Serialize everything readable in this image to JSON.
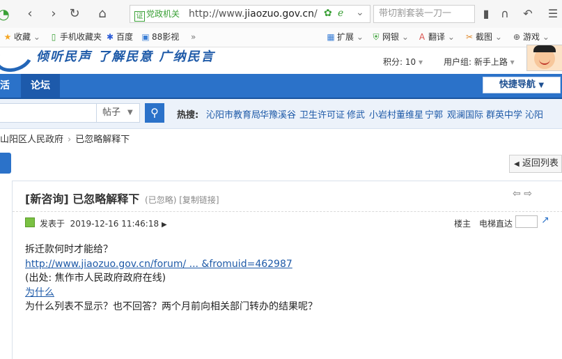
{
  "browser": {
    "cert_label": "党政机关",
    "cert_icon": "证",
    "url_prefix": "http://www.",
    "url_domain": "jiaozuo.gov.cn",
    "url_suffix": "/",
    "search_placeholder": "带切割套装一刀一"
  },
  "bookmarks": [
    {
      "icon": "star-icon",
      "label": "收藏"
    },
    {
      "icon": "phone-icon",
      "label": "手机收藏夹"
    },
    {
      "icon": "paw-icon",
      "label": "百度"
    },
    {
      "icon": "film-icon",
      "label": "88影视"
    },
    {
      "icon": "grid-icon",
      "label": "扩展"
    },
    {
      "icon": "shield-icon",
      "label": "网银"
    },
    {
      "icon": "translate-icon",
      "label": "翻译"
    },
    {
      "icon": "scissors-icon",
      "label": "截图"
    },
    {
      "icon": "gamepad-icon",
      "label": "游戏"
    }
  ],
  "site": {
    "slogan": "倾听民声 了解民意 广纳民言",
    "credit_label": "积分: 10",
    "usergroup_label": "用户组: 新手上路"
  },
  "nav": {
    "items": [
      "活",
      "论坛"
    ],
    "quick_nav": "快捷导航"
  },
  "search": {
    "type": "帖子",
    "hot_label": "热搜:",
    "hot_items": [
      "沁阳市教育局",
      "华豫溪谷",
      "卫生许可证",
      "修武",
      "小岩村董维星",
      "宁郭",
      "观澜国际",
      "群英中学",
      "沁阳"
    ]
  },
  "breadcrumb": {
    "parent": "山阳区人民政府",
    "current": "已忽略解释下"
  },
  "actions": {
    "back_list": "返回列表"
  },
  "post": {
    "title": "[新咨询] 已忽略解释下",
    "status": "(已忽略)",
    "copy_link": "[复制链接]",
    "posted_label": "发表于",
    "posted_time": "2019-12-16 11:46:18",
    "landlord": "楼主",
    "elevator": "电梯直达",
    "body": {
      "line1": "拆迁款何时才能给？",
      "link": "http://www.jiaozuo.gov.cn/forum/ ... &fromuid=462987",
      "source": "(出处: 焦作市人民政府政府在线)",
      "why": "为什么",
      "line5": "为什么列表不显示？也不回答？两个月前向相关部门转办的结果呢？"
    }
  }
}
